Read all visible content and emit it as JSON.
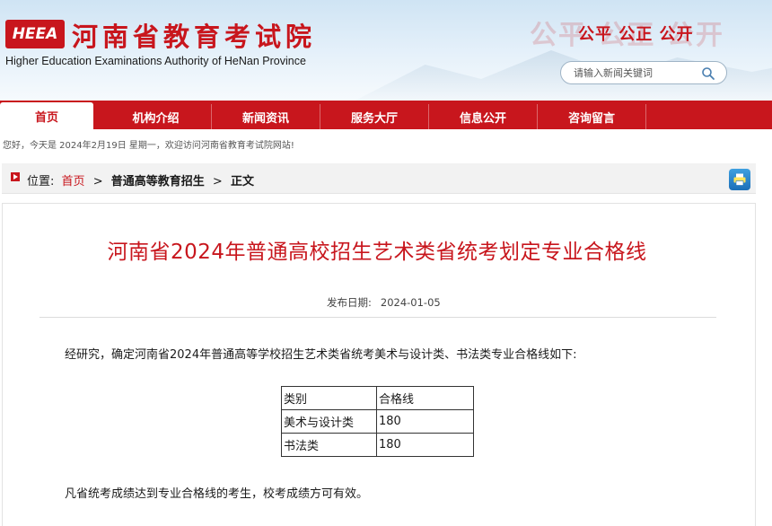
{
  "header": {
    "logo_text": "HEEA",
    "site_name": "河南省教育考试院",
    "site_name_en": "Higher Education Examinations Authority of HeNan Province",
    "slogan": "公平 公正 公开",
    "slogan_ghost": "公平 公正 公开",
    "search_placeholder": "请输入新闻关键词",
    "brand_color": "#c8161d"
  },
  "nav": {
    "items": [
      "首页",
      "机构介绍",
      "新闻资讯",
      "服务大厅",
      "信息公开",
      "咨询留言"
    ],
    "active": "首页"
  },
  "welcome_text": "您好，今天是 2024年2月19日 星期一，欢迎访问河南省教育考试院网站!",
  "breadcrumb": {
    "label": "位置:",
    "items": [
      "首页",
      "普通高等教育招生",
      "正文"
    ],
    "separator": ">"
  },
  "article": {
    "title": "河南省2024年普通高校招生艺术类省统考划定专业合格线",
    "date_label": "发布日期:",
    "date": "2024-01-05",
    "intro": "经研究，确定河南省2024年普通高等学校招生艺术类省统考美术与设计类、书法类专业合格线如下:",
    "table": {
      "headers": [
        "类别",
        "合格线"
      ],
      "rows": [
        [
          "美术与设计类",
          "180"
        ],
        [
          "书法类",
          "180"
        ]
      ]
    },
    "closing": "凡省统考成绩达到专业合格线的考生，校考成绩方可有效。"
  }
}
